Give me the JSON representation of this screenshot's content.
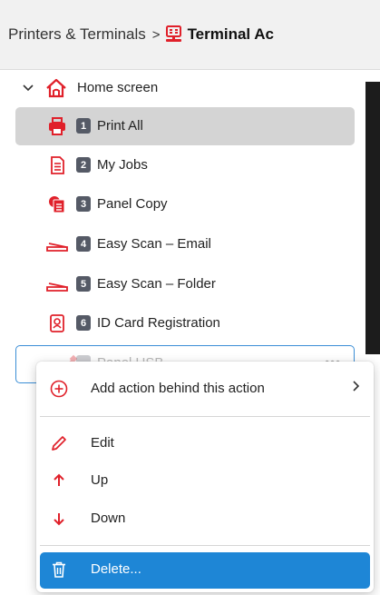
{
  "breadcrumb": {
    "root": "Printers & Terminals",
    "separator": ">",
    "current": "Terminal Ac"
  },
  "tree": {
    "root_label": "Home screen",
    "items": [
      {
        "number": "1",
        "label": "Print All",
        "icon": "printer-icon",
        "selected": true
      },
      {
        "number": "2",
        "label": "My Jobs",
        "icon": "document-icon"
      },
      {
        "number": "3",
        "label": "Panel Copy",
        "icon": "copy-icon"
      },
      {
        "number": "4",
        "label": "Easy Scan – Email",
        "icon": "scanner-icon"
      },
      {
        "number": "5",
        "label": "Easy Scan – Folder",
        "icon": "scanner-icon"
      },
      {
        "number": "6",
        "label": "ID Card Registration",
        "icon": "id-card-icon"
      },
      {
        "number": "",
        "label": "Panel USB",
        "icon": "usb-icon"
      }
    ]
  },
  "context_menu": {
    "add_behind": "Add action behind this action",
    "edit": "Edit",
    "up": "Up",
    "down": "Down",
    "delete": "Delete..."
  },
  "colors": {
    "accent": "#e0202a",
    "selection": "#d4d4d4",
    "highlight": "#1e86d6",
    "badge": "#555a66"
  }
}
